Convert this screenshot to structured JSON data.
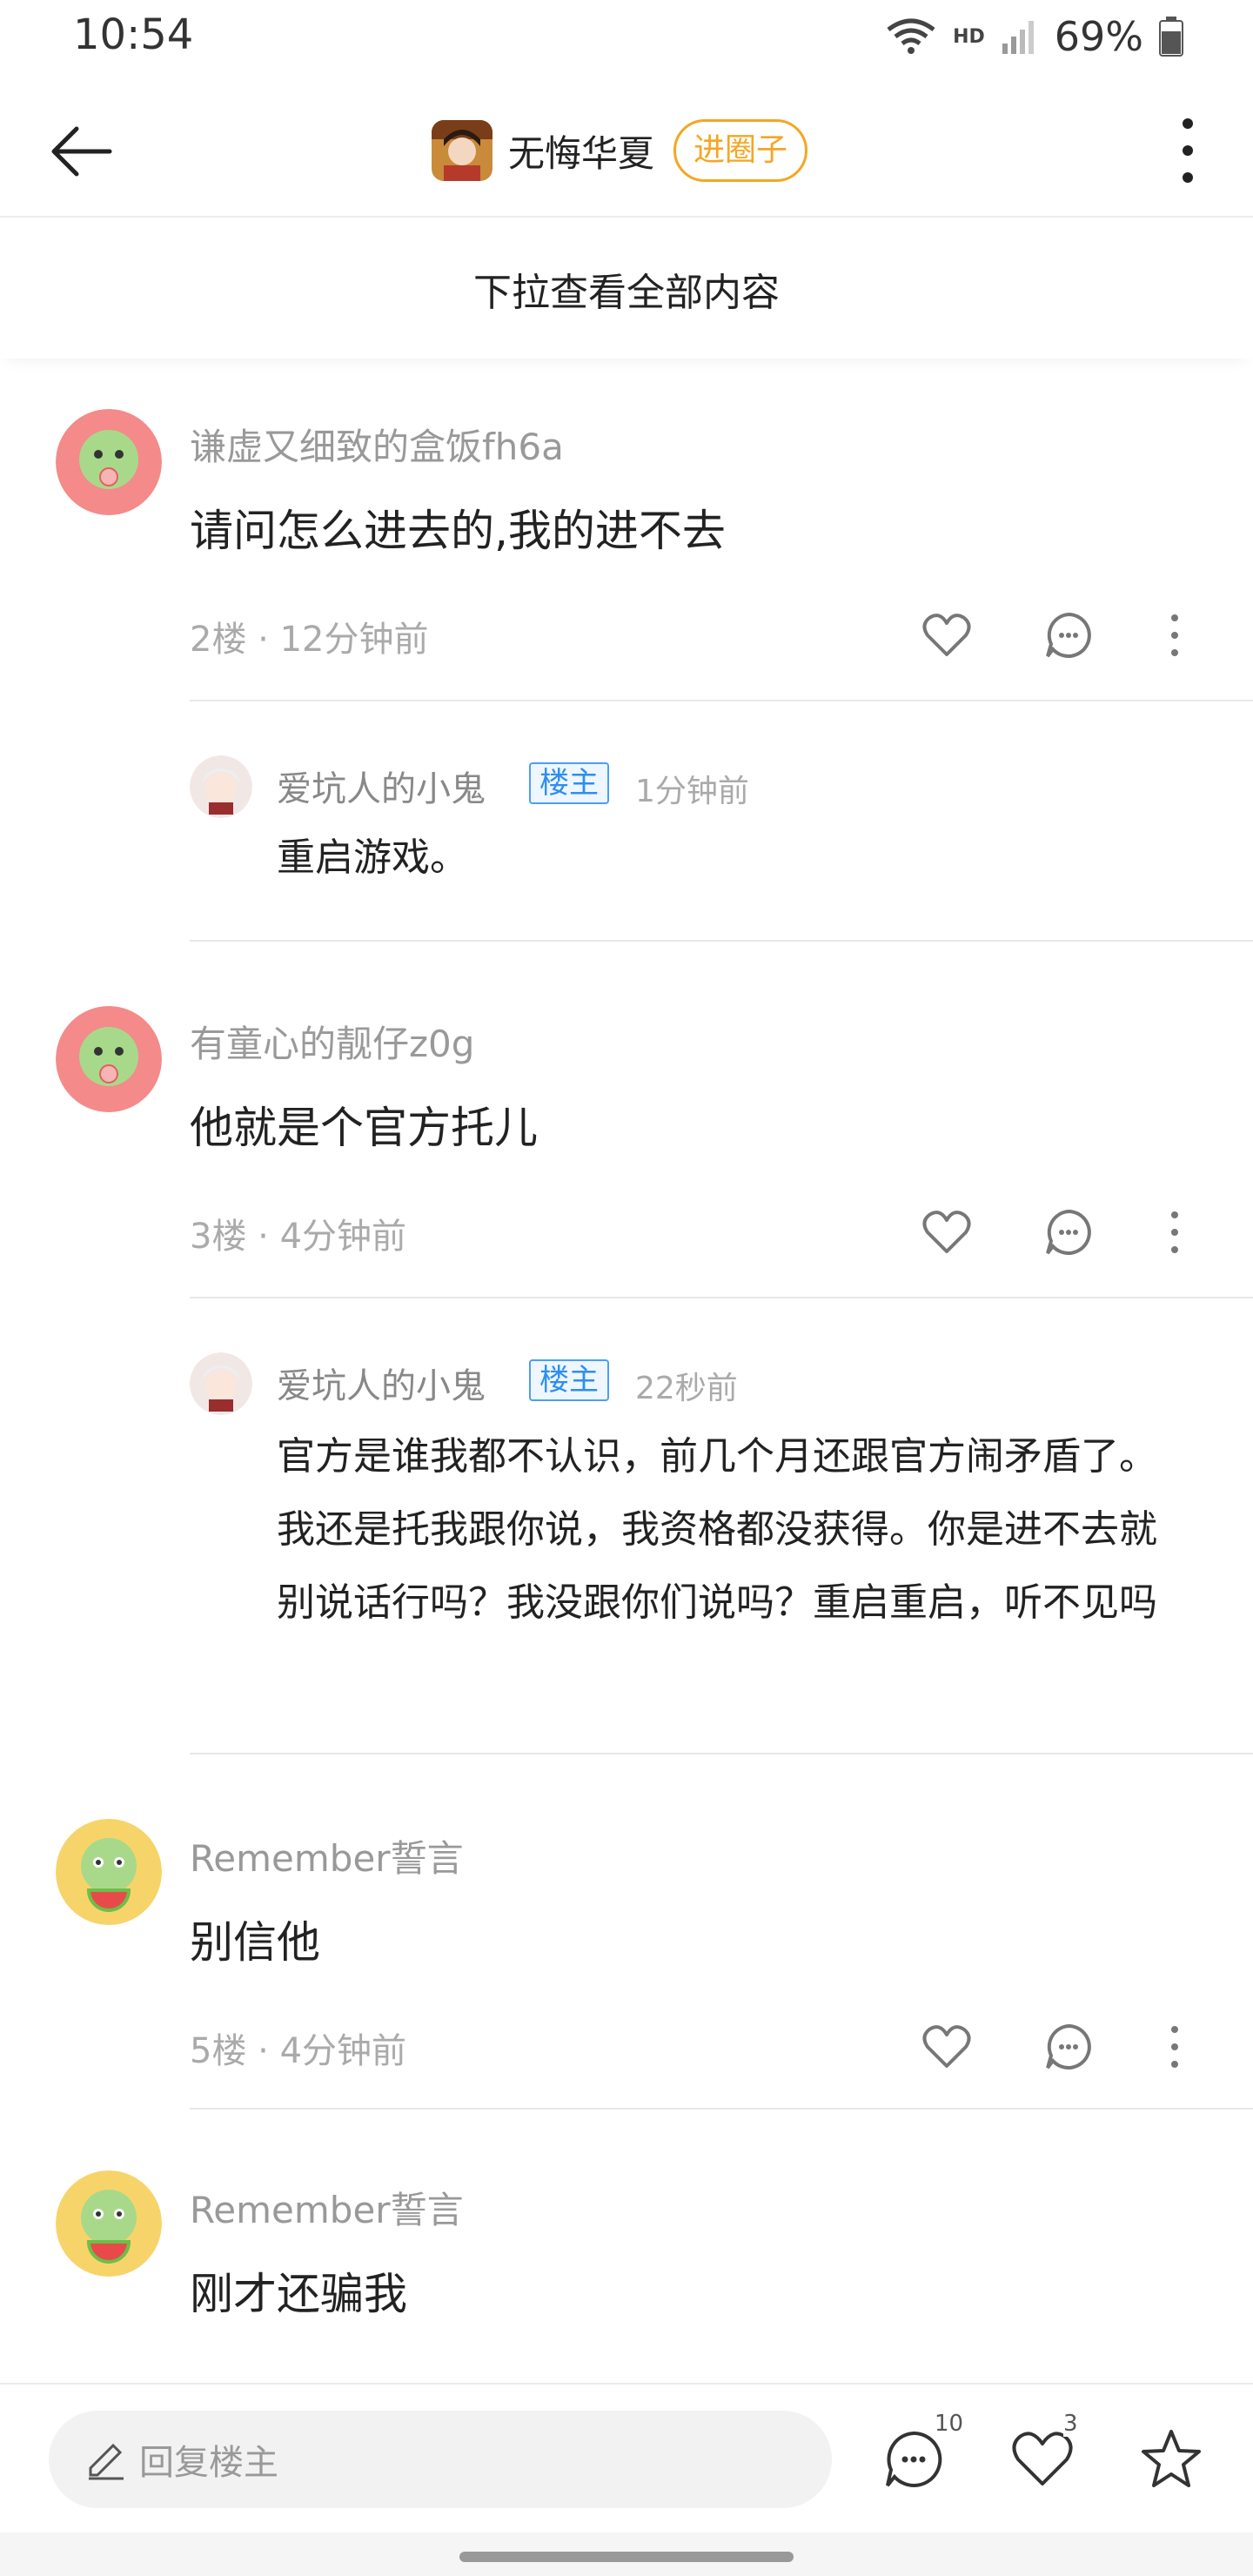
{
  "status": {
    "time": "10:54",
    "hd": "HD",
    "battery": "69%"
  },
  "header": {
    "title": "无悔华夏",
    "join_label": "进圈子"
  },
  "pull_hint": "下拉查看全部内容",
  "comments": [
    {
      "name": "谦虚又细致的盒饭fh6a",
      "text": "请问怎么进去的,我的进不去",
      "meta": "2楼 · 12分钟前",
      "reply": {
        "name": "爱坑人的小鬼",
        "badge": "楼主",
        "time": "1分钟前",
        "text": "重启游戏。"
      }
    },
    {
      "name": "有童心的靓仔z0g",
      "text": "他就是个官方托儿",
      "meta": "3楼 · 4分钟前",
      "reply": {
        "name": "爱坑人的小鬼",
        "badge": "楼主",
        "time": "22秒前",
        "text": "官方是谁我都不认识，前几个月还跟官方闹矛盾了。我还是托我跟你说，我资格都没获得。你是进不去就别说话行吗？我没跟你们说吗？重启重启，听不见吗"
      }
    },
    {
      "name": "Remember誓言",
      "text": "别信他",
      "meta": "5楼 · 4分钟前"
    },
    {
      "name": "Remember誓言",
      "text": "刚才还骗我"
    }
  ],
  "bottom": {
    "placeholder": "回复楼主",
    "comment_count": "10",
    "like_count": "3"
  },
  "colors": {
    "accent": "#f5a623",
    "badge_blue": "#2d8ef0",
    "avatar_green": "#8fcf6a",
    "avatar_pink": "#f48a8a"
  }
}
